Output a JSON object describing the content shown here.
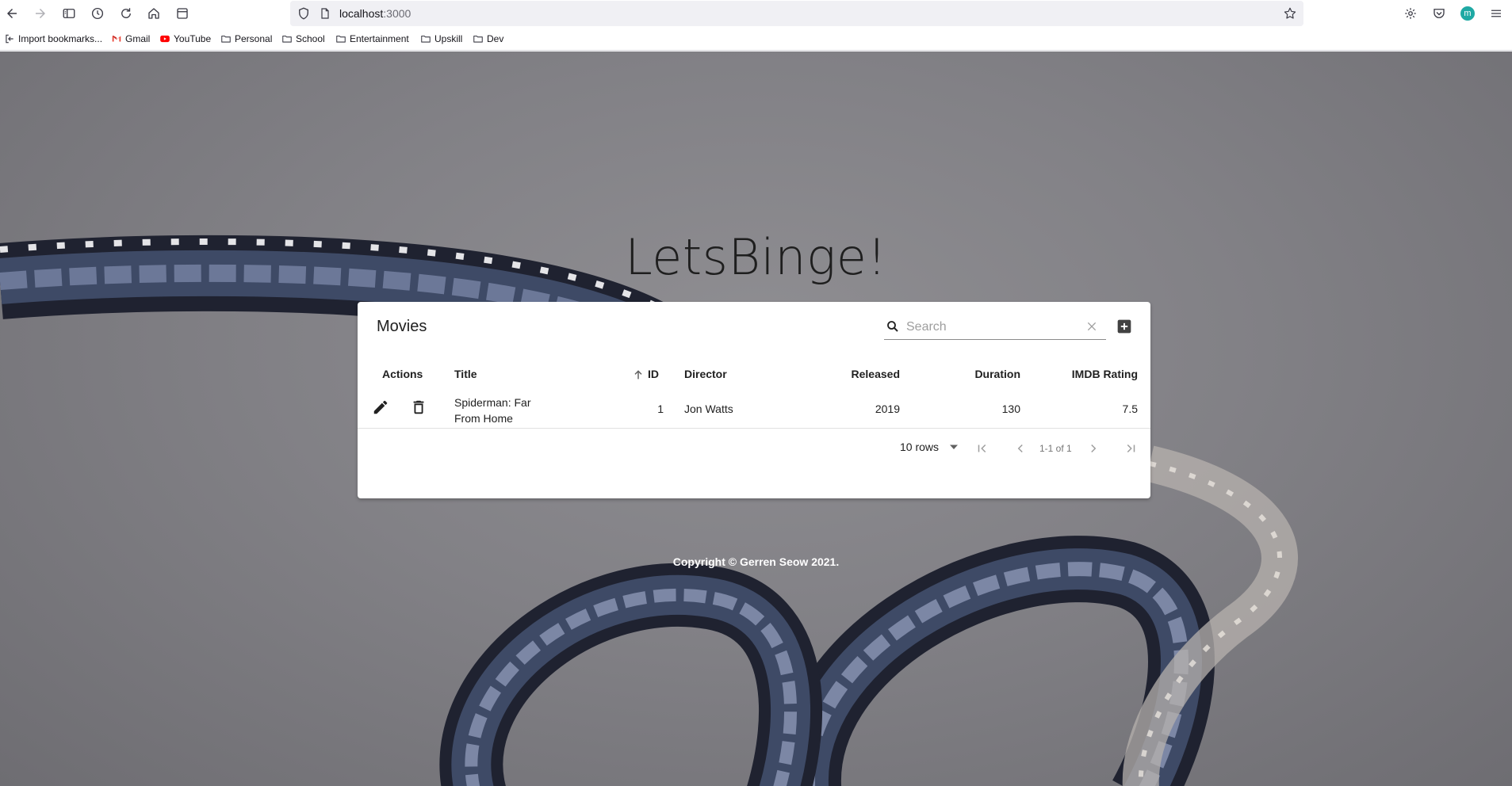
{
  "browser": {
    "url_host": "localhost",
    "url_port": ":3000",
    "bookmarks": [
      {
        "label": "Import bookmarks...",
        "icon": "import-icon"
      },
      {
        "label": "Gmail",
        "icon": "gmail-icon"
      },
      {
        "label": "YouTube",
        "icon": "youtube-icon"
      },
      {
        "label": "Personal",
        "icon": "folder-icon"
      },
      {
        "label": "School",
        "icon": "folder-icon"
      },
      {
        "label": "Entertainment",
        "icon": "folder-icon"
      },
      {
        "label": "Upskill",
        "icon": "folder-icon"
      },
      {
        "label": "Dev",
        "icon": "folder-icon"
      }
    ],
    "profile_initial": "m"
  },
  "app": {
    "title": "LetsBinge!",
    "copyright": "Copyright © Gerren Seow 2021."
  },
  "table": {
    "title": "Movies",
    "search_placeholder": "Search",
    "columns": [
      "Actions",
      "Title",
      "ID",
      "Director",
      "Released",
      "Duration",
      "IMDB Rating"
    ],
    "sort_column": "ID",
    "sort_direction": "asc",
    "rows": [
      {
        "title_line1": "Spiderman: Far",
        "title_line2": "From Home",
        "id": "1",
        "director": "Jon Watts",
        "released": "2019",
        "duration": "130",
        "rating": "7.5"
      }
    ],
    "pagination": {
      "rows_per_page": "10 rows",
      "info": "1-1 of 1"
    }
  },
  "colors": {
    "profile_avatar": "#1fa9a4",
    "youtube_red": "#ff0000",
    "card_bg": "#ffffff"
  }
}
